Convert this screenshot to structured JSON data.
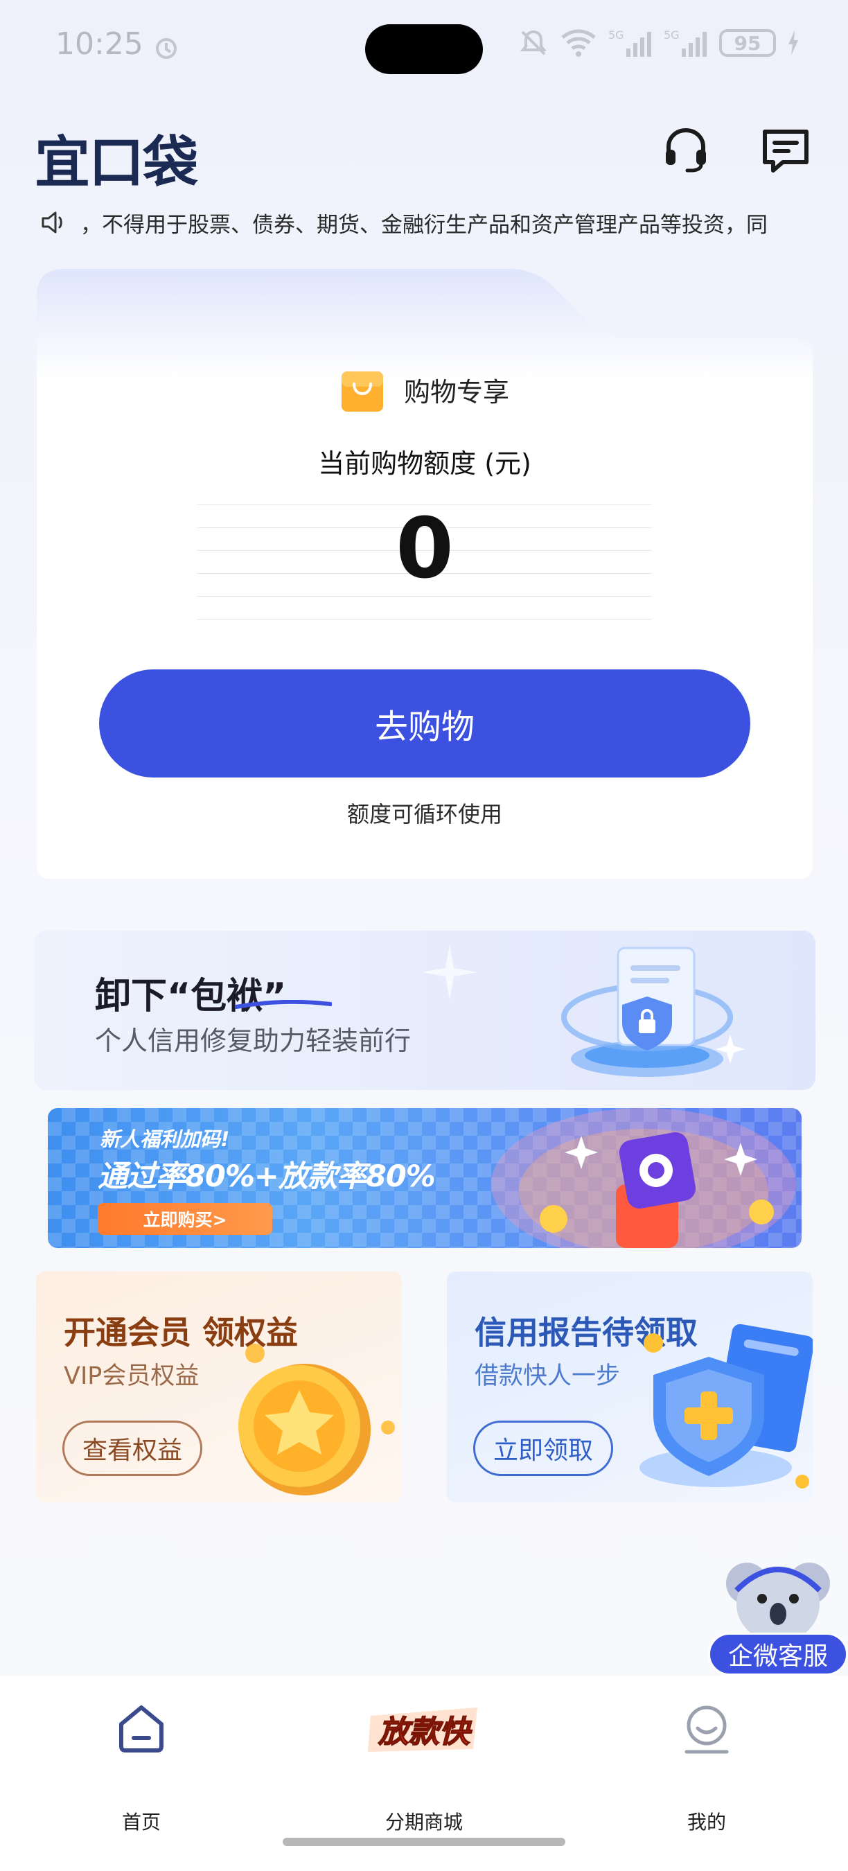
{
  "status_bar": {
    "time": "10:25",
    "battery": "95"
  },
  "header": {
    "logo": "宜口袋"
  },
  "notice": {
    "text": "，不得用于股票、债券、期货、金融衍生产品和资产管理产品等投资，同"
  },
  "quota_card": {
    "shop_label": "购物专享",
    "quota_title": "当前购物额度 (元)",
    "quota_value": "0",
    "shop_button": "去购物",
    "cycle_note": "额度可循环使用"
  },
  "banner_repair": {
    "title": "卸下“包袱”",
    "subtitle": "个人信用修复助力轻装前行"
  },
  "banner_newcomer": {
    "tag": "新人福利加码!",
    "title": "通过率80%+放款率80%",
    "button": "立即购买>"
  },
  "tile_vip": {
    "title": "开通会员 领权益",
    "subtitle": "VIP会员权益",
    "button": "查看权益"
  },
  "tile_credit": {
    "title": "信用报告待领取",
    "subtitle": "借款快人一步",
    "button": "立即领取"
  },
  "floating_service": {
    "label": "企微客服"
  },
  "tabbar": {
    "home": "首页",
    "mall": "分期商城",
    "mall_badge": "放款快",
    "mine": "我的"
  },
  "colors": {
    "brand_blue": "#3d51e1",
    "logo_navy": "#1b2a52",
    "vip_brown": "#8a3d10",
    "credit_blue": "#2c59b8"
  }
}
